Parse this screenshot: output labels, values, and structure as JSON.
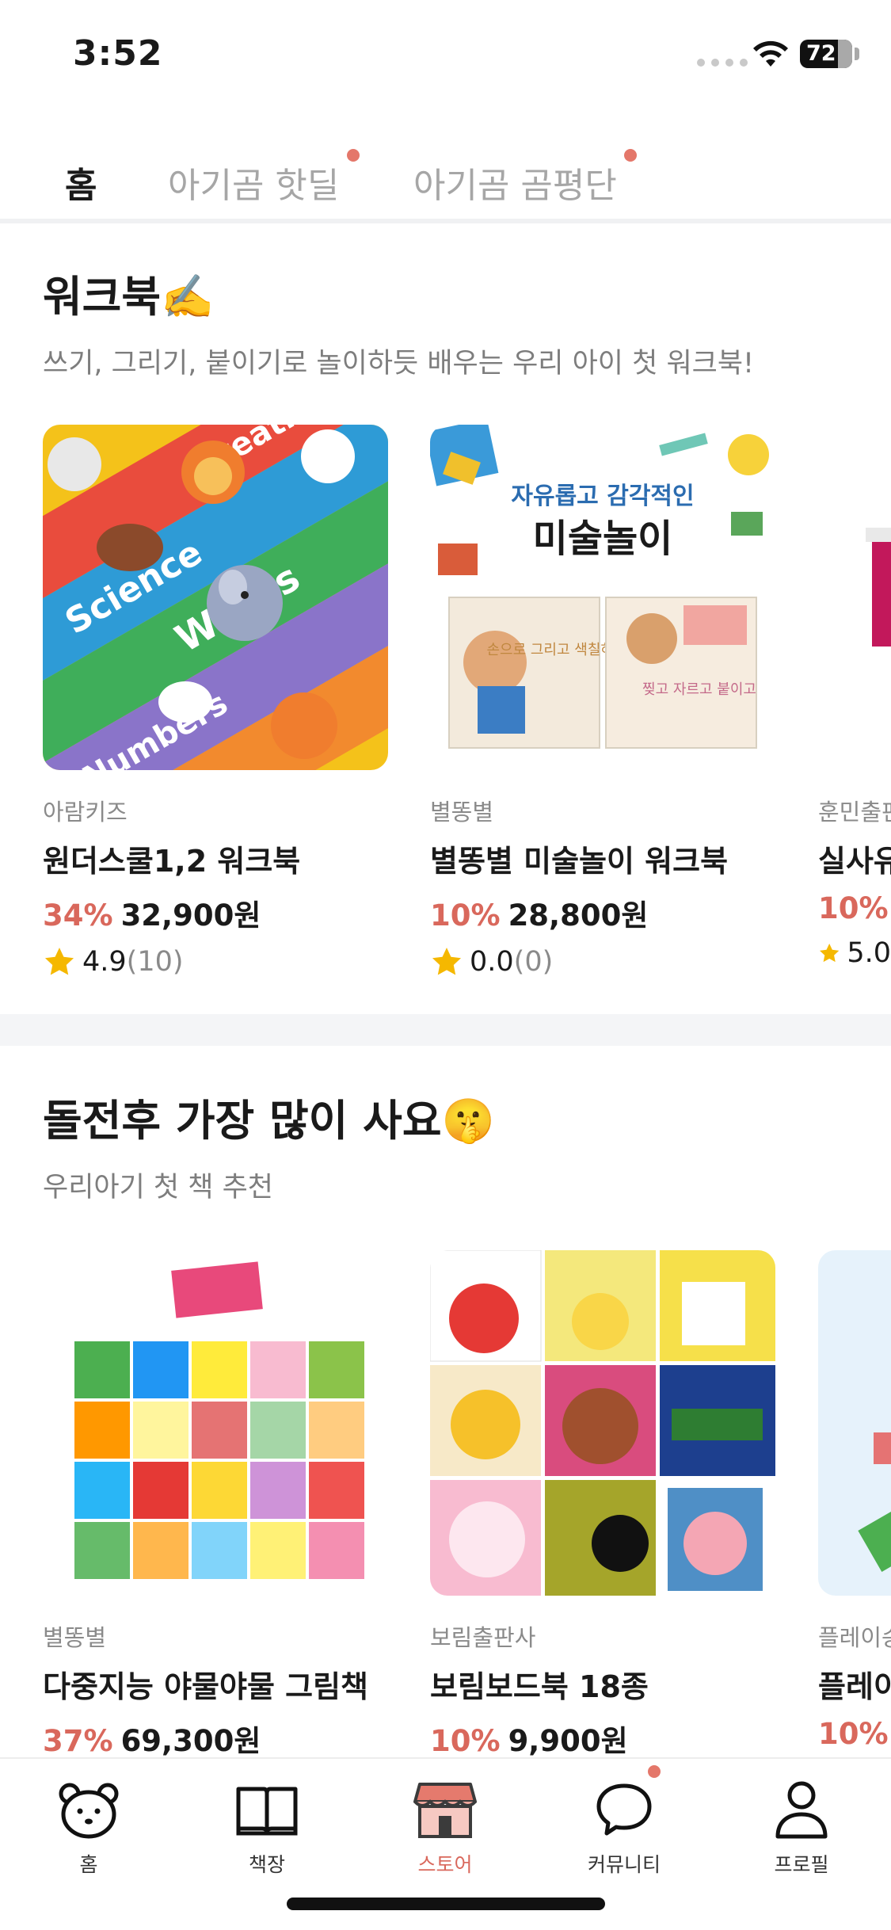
{
  "status_bar": {
    "time": "3:52",
    "battery": "72"
  },
  "top_tabs": [
    {
      "label": "홈",
      "active": true,
      "dot": false
    },
    {
      "label": "아기곰 핫딜",
      "active": false,
      "dot": true
    },
    {
      "label": "아기곰 곰평단",
      "active": false,
      "dot": true
    }
  ],
  "workbook": {
    "title": "워크북✍️",
    "subtitle": "쓰기, 그리기, 붙이기로 놀이하듯 배우는 우리 아이 첫 워크북!",
    "products": [
      {
        "publisher": "아람키즈",
        "title": "원더스쿨1,2 워크북",
        "discount": "34%",
        "price": "32,900원",
        "rating": "4.9",
        "review_count": "(10)"
      },
      {
        "publisher": "별똥별",
        "title": "별똥별 미술놀이 워크북",
        "discount": "10%",
        "price": "28,800원",
        "rating": "0.0",
        "review_count": "(0)",
        "cover_heading_a": "자유롭고 감각적인",
        "cover_heading_b": "미술놀이",
        "cover_book_1": "손으로 그리고 색칠하고",
        "cover_book_2": "찢고 자르고 붙이고"
      },
      {
        "publisher": "훈민출판",
        "title": "실사유",
        "discount": "10%",
        "price": "",
        "rating": "5.0",
        "review_count": ""
      }
    ]
  },
  "popular": {
    "title": "돌전후 가장 많이 사요🤫",
    "subtitle": "우리아기 첫 책 추천",
    "products": [
      {
        "publisher": "별똥별",
        "title": "다중지능 야물야물 그림책",
        "discount": "37%",
        "price": "69,300원"
      },
      {
        "publisher": "보림출판사",
        "title": "보림보드북 18종",
        "discount": "10%",
        "price": "9,900원"
      },
      {
        "publisher": "플레이송",
        "title": "플레이",
        "discount": "10%",
        "price": ""
      }
    ]
  },
  "bottom_nav": [
    {
      "label": "홈",
      "icon": "bear-icon",
      "active": false,
      "dot": false
    },
    {
      "label": "책장",
      "icon": "book-icon",
      "active": false,
      "dot": false
    },
    {
      "label": "스토어",
      "icon": "store-icon",
      "active": true,
      "dot": false
    },
    {
      "label": "커뮤니티",
      "icon": "chat-icon",
      "active": false,
      "dot": true
    },
    {
      "label": "프로필",
      "icon": "person-icon",
      "active": false,
      "dot": false
    }
  ],
  "colors": {
    "accent": "#d9685c",
    "dot": "#e4776a",
    "star": "#f5b800",
    "muted": "#8a8a8a"
  }
}
